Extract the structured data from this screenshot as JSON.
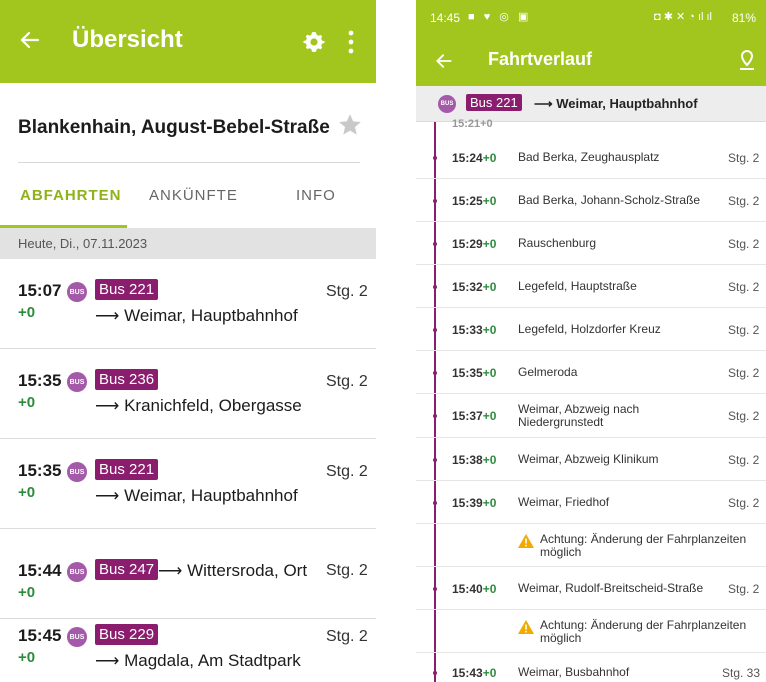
{
  "left": {
    "title": "Übersicht",
    "stop_name": "Blankenhain, August-Bebel-Straße",
    "tabs": [
      {
        "label": "ABFAHRTEN",
        "active": true
      },
      {
        "label": "ANKÜNFTE",
        "active": false
      },
      {
        "label": "INFO",
        "active": false
      }
    ],
    "date": "Heute, Di., 07.11.2023",
    "departures": [
      {
        "time": "15:07",
        "delay": "+0",
        "line": "Bus 221",
        "destination": "⟶ Weimar, Hauptbahnhof",
        "platform": "Stg. 2"
      },
      {
        "time": "15:35",
        "delay": "+0",
        "line": "Bus 236",
        "destination": "⟶ Kranichfeld, Obergasse",
        "platform": "Stg. 2"
      },
      {
        "time": "15:35",
        "delay": "+0",
        "line": "Bus 221",
        "destination": "⟶ Weimar, Hauptbahnhof",
        "platform": "Stg. 2"
      },
      {
        "time": "15:44",
        "delay": "+0",
        "line": "Bus 247",
        "destination": "⟶ Wittersroda, Ort",
        "platform": "Stg. 2"
      },
      {
        "time": "15:45",
        "delay": "+0",
        "line": "Bus 229",
        "destination": "⟶ Magdala, Am Stadtpark",
        "platform": "Stg. 2"
      }
    ]
  },
  "right": {
    "status": {
      "clock": "14:45",
      "battery": "81%"
    },
    "title": "Fahrtverlauf",
    "line": "Bus 221",
    "direction": "⟶ Weimar, Hauptbahnhof",
    "partial_row": "15:21+0",
    "stops": [
      {
        "time": "15:24",
        "delay": "+0",
        "name": "Bad Berka, Zeughausplatz",
        "platform": "Stg. 2"
      },
      {
        "time": "15:25",
        "delay": "+0",
        "name": "Bad Berka, Johann-Scholz-Straße",
        "platform": "Stg. 2"
      },
      {
        "time": "15:29",
        "delay": "+0",
        "name": "Rauschenburg",
        "platform": "Stg. 2"
      },
      {
        "time": "15:32",
        "delay": "+0",
        "name": "Legefeld, Hauptstraße",
        "platform": "Stg. 2"
      },
      {
        "time": "15:33",
        "delay": "+0",
        "name": "Legefeld, Holzdorfer Kreuz",
        "platform": "Stg. 2"
      },
      {
        "time": "15:35",
        "delay": "+0",
        "name": "Gelmeroda",
        "platform": "Stg. 2"
      },
      {
        "time": "15:37",
        "delay": "+0",
        "name": "Weimar, Abzweig nach Niedergrunstedt",
        "platform": "Stg. 2"
      },
      {
        "time": "15:38",
        "delay": "+0",
        "name": "Weimar, Abzweig Klinikum",
        "platform": "Stg. 2"
      },
      {
        "time": "15:39",
        "delay": "+0",
        "name": "Weimar, Friedhof",
        "platform": "Stg. 2"
      },
      {
        "time": "15:40",
        "delay": "+0",
        "name": "Weimar, Rudolf-Breitscheid-Straße",
        "platform": "Stg. 2"
      },
      {
        "time": "15:43",
        "delay": "+0",
        "name": "Weimar, Busbahnhof",
        "platform": "Stg. 33"
      }
    ],
    "warning_text": "Achtung: Änderung der Fahrplanzeiten möglich"
  },
  "colors": {
    "brand_green": "#a3c61f",
    "line_purple": "#8b1d6e",
    "bus_icon": "#a35aa8",
    "delay_green": "#2e8b3e"
  },
  "icons": [
    "back-arrow-icon",
    "gear-icon",
    "more-vert-icon",
    "star-icon",
    "bus-icon",
    "map-pin-icon",
    "warning-icon"
  ]
}
